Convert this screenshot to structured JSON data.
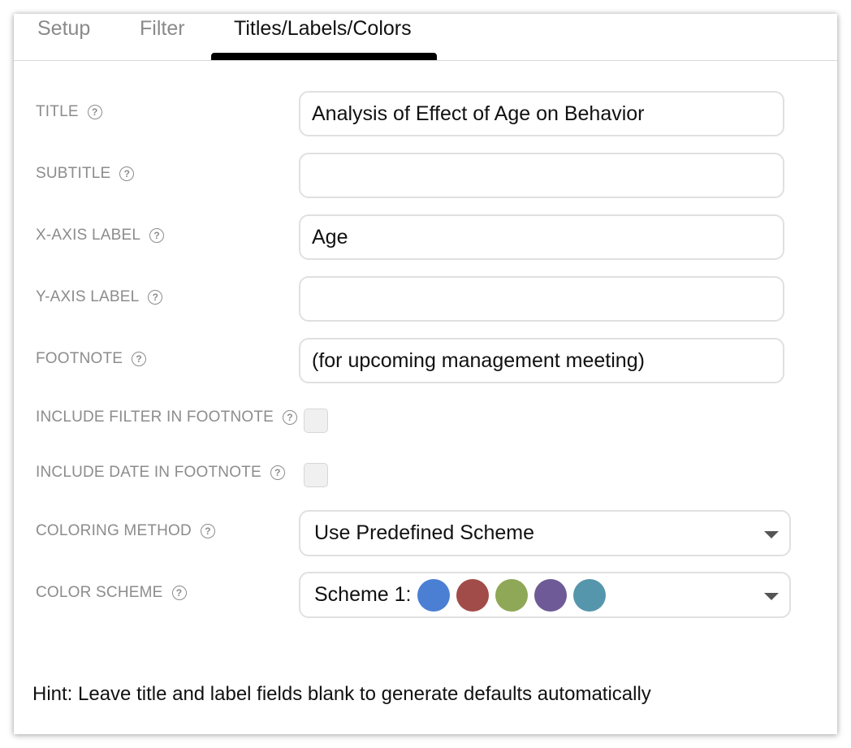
{
  "tabs": [
    {
      "label": "Setup",
      "active": false
    },
    {
      "label": "Filter",
      "active": false
    },
    {
      "label": "Titles/Labels/Colors",
      "active": true
    }
  ],
  "form": {
    "title": {
      "label": "TITLE",
      "value": "Analysis of Effect of Age on Behavior"
    },
    "subtitle": {
      "label": "SUBTITLE",
      "value": ""
    },
    "x_axis_label": {
      "label": "X-AXIS LABEL",
      "value": "Age"
    },
    "y_axis_label": {
      "label": "Y-AXIS LABEL",
      "value": ""
    },
    "footnote": {
      "label": "FOOTNOTE",
      "value": "(for upcoming management meeting)"
    },
    "include_filter": {
      "label": "INCLUDE FILTER IN FOOTNOTE",
      "checked": false
    },
    "include_date": {
      "label": "INCLUDE DATE IN FOOTNOTE",
      "checked": false
    },
    "coloring_method": {
      "label": "COLORING METHOD",
      "selected": "Use Predefined Scheme"
    },
    "color_scheme": {
      "label": "COLOR SCHEME",
      "selected": "Scheme 1:",
      "colors": [
        "#4a7fd4",
        "#a14c48",
        "#8fa857",
        "#6e5a96",
        "#5696ac"
      ]
    }
  },
  "help_glyph": "?",
  "icons": {
    "help": "help-circle-icon",
    "dropdown": "caret-down-icon"
  },
  "hint": "Hint: Leave title and label fields blank to generate defaults automatically"
}
